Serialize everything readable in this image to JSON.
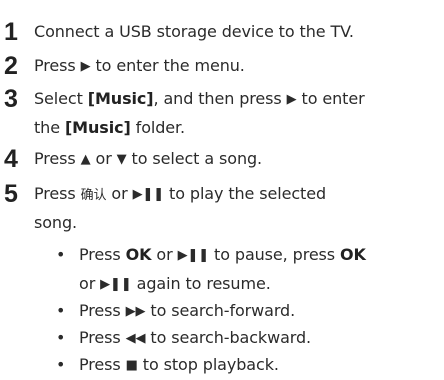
{
  "steps": [
    {
      "number": "1",
      "line1": "Connect a USB storage device to the TV."
    },
    {
      "number": "2",
      "pre": "Press ",
      "icon": "▶",
      "post": " to enter the menu."
    },
    {
      "number": "3",
      "pre": "Select ",
      "bold1": "[Music]",
      "mid": ", and then press ",
      "icon": "▶",
      "post": " to enter",
      "line2_pre": "the ",
      "bold2": "[Music]",
      "line2_post": " folder."
    },
    {
      "number": "4",
      "pre": "Press ",
      "icon1": "▲",
      "mid": " or ",
      "icon2": "▼",
      "post": " to select a song."
    },
    {
      "number": "5",
      "pre": "Press ",
      "cjk": "确认",
      "mid": " or ",
      "icon": "▶❚❚",
      "post": " to play the selected",
      "line2": "song."
    }
  ],
  "substeps": [
    {
      "bullet": "•",
      "pre": "Press ",
      "bold1": "OK",
      "mid1": " or ",
      "icon1": "▶❚❚",
      "mid2": " to pause, press ",
      "bold2": "OK",
      "line2_pre": "or ",
      "icon2": "▶❚❚",
      "line2_post": " again to resume."
    },
    {
      "bullet": "•",
      "pre": "Press ",
      "icon": "▶▶",
      "post": " to search-forward."
    },
    {
      "bullet": "•",
      "pre": "Press ",
      "icon": "◀◀",
      "post": " to search-backward."
    },
    {
      "bullet": "•",
      "pre": "Press ",
      "icon": "■",
      "post": " to stop playback."
    }
  ]
}
